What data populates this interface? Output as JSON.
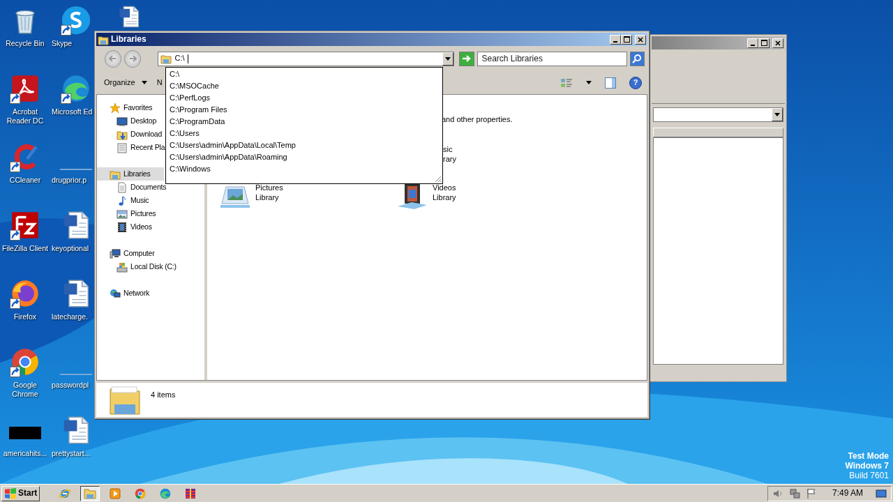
{
  "desktop_icons": [
    {
      "label": "Recycle Bin",
      "kind": "recycle",
      "shortcut": false
    },
    {
      "label": "Skype",
      "kind": "skype",
      "shortcut": true
    },
    {
      "kind": "word",
      "shortcut": false
    },
    {
      "label": "Acrobat Reader DC",
      "kind": "acrobat",
      "shortcut": true
    },
    {
      "label": "Microsoft Ed",
      "kind": "edge",
      "shortcut": true
    },
    {
      "label": "CCleaner",
      "kind": "ccleaner",
      "shortcut": true
    },
    {
      "label": "drugprior.p",
      "kind": "blank",
      "shortcut": false
    },
    {
      "label": "FileZilla Client",
      "kind": "filezilla",
      "shortcut": true
    },
    {
      "label": "keyoptional",
      "kind": "word",
      "shortcut": false
    },
    {
      "label": "Firefox",
      "kind": "firefox",
      "shortcut": true
    },
    {
      "label": "latecharge.",
      "kind": "word",
      "shortcut": false
    },
    {
      "label": "Google Chrome",
      "kind": "chrome",
      "shortcut": true
    },
    {
      "label": "passwordpl",
      "kind": "blank",
      "shortcut": false
    },
    {
      "label": "americahits...",
      "kind": "thumb",
      "shortcut": false
    },
    {
      "label": "prettystart...",
      "kind": "word",
      "shortcut": false
    }
  ],
  "back_window": {
    "active": false
  },
  "explorer": {
    "title": "Libraries",
    "active": true,
    "address": "C:\\",
    "search": {
      "placeholder": "Search Libraries"
    },
    "toolbar": [
      {
        "label": "Organize",
        "dropdown": true
      },
      {
        "label": "N",
        "dropdown": false
      }
    ],
    "help": "?",
    "autocomplete": [
      "C:\\",
      "C:\\MSOCache",
      "C:\\PerfLogs",
      "C:\\Program Files",
      "C:\\ProgramData",
      "C:\\Users",
      "C:\\Users\\admin\\AppData\\Local\\Temp",
      "C:\\Users\\admin\\AppData\\Roaming",
      "C:\\Windows"
    ],
    "nav": [
      {
        "label": "Favorites",
        "kind": "star",
        "selected": false,
        "children": [
          {
            "label": "Desktop",
            "kind": "desktop",
            "selected": false
          },
          {
            "label": "Download",
            "kind": "downloads",
            "selected": false
          },
          {
            "label": "Recent Pla",
            "kind": "recent",
            "selected": false
          }
        ]
      },
      {
        "label": "Libraries",
        "kind": "libraries",
        "selected": true,
        "children": [
          {
            "label": "Documents",
            "kind": "documents",
            "selected": false
          },
          {
            "label": "Music",
            "kind": "music",
            "selected": false
          },
          {
            "label": "Pictures",
            "kind": "pictures",
            "selected": false
          },
          {
            "label": "Videos",
            "kind": "videos",
            "selected": false
          }
        ]
      },
      {
        "label": "Computer",
        "kind": "computer",
        "selected": false,
        "children": [
          {
            "label": "Local Disk (C:)",
            "kind": "disk",
            "selected": false
          }
        ]
      },
      {
        "label": "Network",
        "kind": "network",
        "selected": false
      }
    ],
    "content": {
      "description": "and other properties.",
      "libraries": [
        {
          "kind": "music",
          "name": "sic",
          "sub": "rary"
        },
        {
          "kind": "pictures",
          "name": "Pictures",
          "sub": "Library"
        },
        {
          "kind": "videos",
          "name": "Videos",
          "sub": "Library"
        }
      ]
    },
    "status": "4 items"
  },
  "taskbar": {
    "start": "Start",
    "buttons": [
      {
        "kind": "ie",
        "selected": false
      },
      {
        "kind": "folder",
        "selected": true
      },
      {
        "kind": "media",
        "selected": false
      },
      {
        "kind": "chrome",
        "selected": false
      },
      {
        "kind": "edge",
        "selected": false
      },
      {
        "kind": "winrar",
        "selected": false
      }
    ],
    "clock": "7:49 AM"
  },
  "os_notice": [
    "Test Mode",
    "Windows 7",
    "Build 7601"
  ]
}
